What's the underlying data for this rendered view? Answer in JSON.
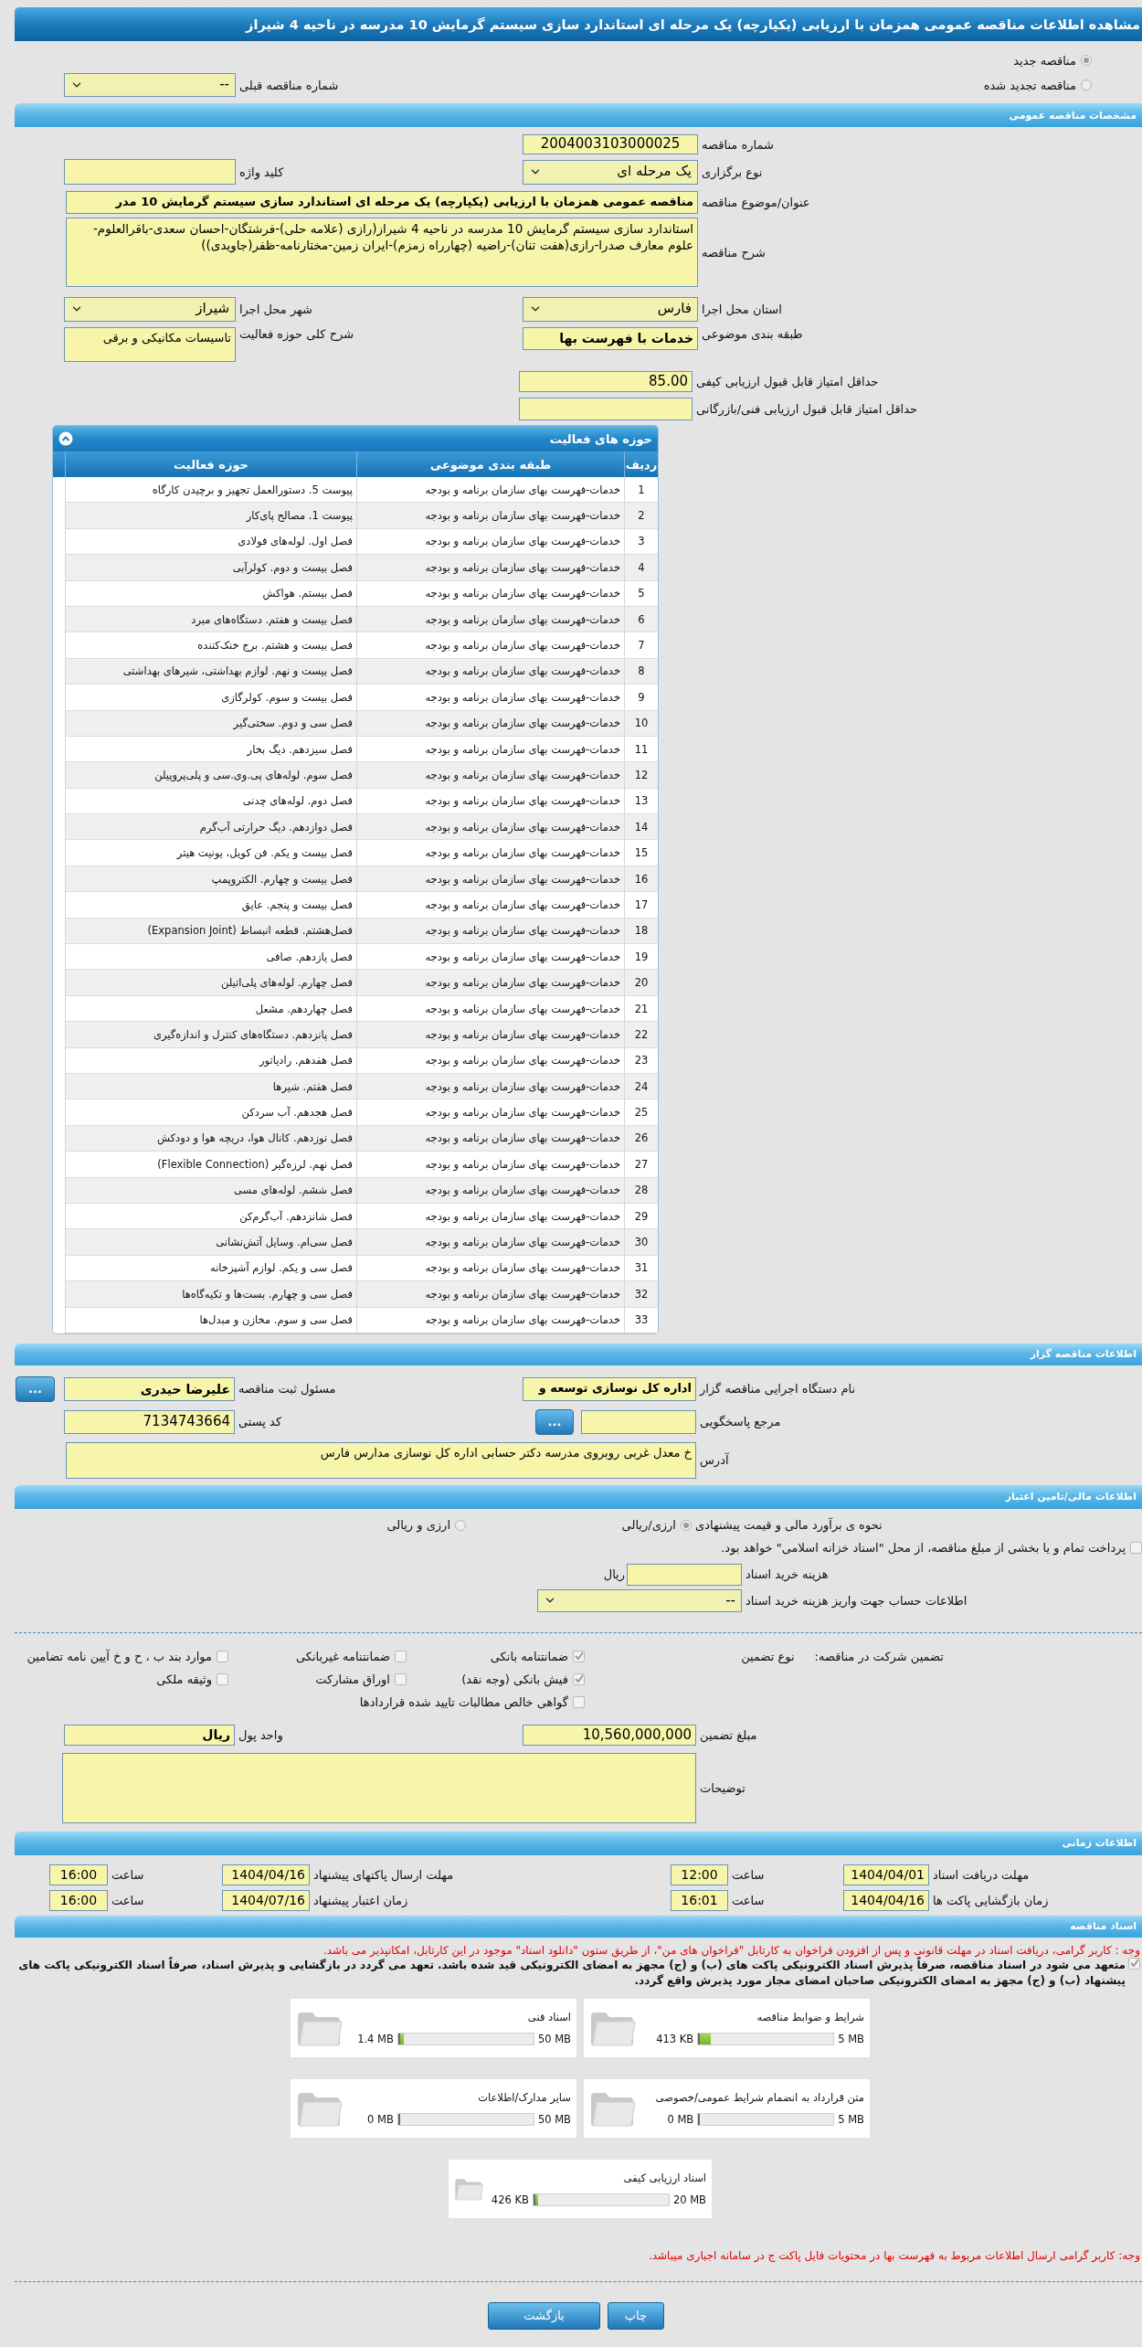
{
  "title": "مشاهده اطلاعات مناقصه عمومی همزمان با ارزیابی (یکپارچه) یک مرحله ای استاندارد سازی سیستم گرمایش 10 مدرسه در ناحیه 4 شیراز",
  "tender_kind": [
    {
      "label": "مناقصه جدید",
      "selected": true
    },
    {
      "label": "مناقصه تجدید شده",
      "selected": false
    }
  ],
  "previous_tender": {
    "label": "شماره مناقصه قبلی",
    "value": "--"
  },
  "general": {
    "header": "مشخصات مناقصه عمومی",
    "tender_number": {
      "label": "شماره مناقصه",
      "value": "2004003103000025"
    },
    "holding_type": {
      "label": "نوع برگزاری",
      "value": "یک مرحله ای"
    },
    "keyword": {
      "label": "کلید واژه"
    },
    "subject": {
      "label": "عنوان/موضوع مناقصه",
      "value": "مناقصه عمومی همزمان با ارزیابی (یکپارچه) یک مرحله ای استاندارد سازی سیستم گرمایش 10 مدر"
    },
    "description": {
      "label": "شرح مناقصه",
      "value": "استاندارد سازی سیستم گرمایش 10 مدرسه در ناحیه 4 شیراز(رازی (علامه حلی)-فرشتگان-احسان سعدی-باقرالعلوم-علوم معارف صدرا-رازی(هفت تنان)-راضیه (چهارراه زمزم)-ایران زمین-مختارنامه-ظفر(جاویدی))"
    },
    "province": {
      "label": "استان محل اجرا",
      "value": "فارس"
    },
    "city": {
      "label": "شهر محل اجرا",
      "value": "شیراز"
    },
    "category": {
      "label": "طبقه بندی موضوعی",
      "value": "خدمات با فهرست بها"
    },
    "activity_summary": {
      "label": "شرح کلی حوزه فعالیت",
      "value": "تاسیسات مکانیکی و برقی"
    },
    "min_quality_score": {
      "label": "حداقل امتیاز قابل قبول ارزیابی کیفی",
      "value": "85.00"
    },
    "min_technical_score": {
      "label": "حداقل امتیاز قابل قبول ارزیابی فنی/بازرگانی"
    }
  },
  "activities": {
    "header": "حوزه های فعالیت",
    "columns": [
      "ردیف",
      "طبقه بندی موضوعی",
      "حوزه فعالیت"
    ],
    "rows": [
      [
        "1",
        "خدمات-فهرست بهای سازمان برنامه و بودجه",
        "پیوست 5. دستورالعمل تجهیز و برچیدن کارگاه"
      ],
      [
        "2",
        "خدمات-فهرست بهای سازمان برنامه و بودجه",
        "پیوست 1. مصالح پای‌کار"
      ],
      [
        "3",
        "خدمات-فهرست بهای سازمان برنامه و بودجه",
        "فصل اول. لوله‌های فولادی"
      ],
      [
        "4",
        "خدمات-فهرست بهای سازمان برنامه و بودجه",
        "فصل بیست و دوم. کولرآبی"
      ],
      [
        "5",
        "خدمات-فهرست بهای سازمان برنامه و بودجه",
        "فصل بیستم. هواکش"
      ],
      [
        "6",
        "خدمات-فهرست بهای سازمان برنامه و بودجه",
        "فصل بیست و هفتم. دستگاه‌های مبرد"
      ],
      [
        "7",
        "خدمات-فهرست بهای سازمان برنامه و بودجه",
        "فصل بیست و هشتم. برج خنک‌کننده"
      ],
      [
        "8",
        "خدمات-فهرست بهای سازمان برنامه و بودجه",
        "فصل بیست و نهم. لوازم بهداشتی، شیرهای بهداشتی"
      ],
      [
        "9",
        "خدمات-فهرست بهای سازمان برنامه و بودجه",
        "فصل بیست و سوم. کولرگازی"
      ],
      [
        "10",
        "خدمات-فهرست بهای سازمان برنامه و بودجه",
        "فصل سی و دوم. سختی‌گیر"
      ],
      [
        "11",
        "خدمات-فهرست بهای سازمان برنامه و بودجه",
        "فصل سیزدهم. دیگ بخار"
      ],
      [
        "12",
        "خدمات-فهرست بهای سازمان برنامه و بودجه",
        "فصل سوم. لوله‌های پی.وی.سی و پلی‌پروپیلن"
      ],
      [
        "13",
        "خدمات-فهرست بهای سازمان برنامه و بودجه",
        "فصل دوم. لوله‌های چدنی"
      ],
      [
        "14",
        "خدمات-فهرست بهای سازمان برنامه و بودجه",
        "فصل دوازدهم. دیگ حرارتی آب‌گرم"
      ],
      [
        "15",
        "خدمات-فهرست بهای سازمان برنامه و بودجه",
        "فصل بیست و یکم. فن کویل، یونیت هیتر"
      ],
      [
        "16",
        "خدمات-فهرست بهای سازمان برنامه و بودجه",
        "فصل بیست و چهارم. الکتروپمپ"
      ],
      [
        "17",
        "خدمات-فهرست بهای سازمان برنامه و بودجه",
        "فصل بیست و پنجم. عایق"
      ],
      [
        "18",
        "خدمات-فهرست بهای سازمان برنامه و بودجه",
        "فصل‌هشتم. قطعه انبساط (Expansion Joint)"
      ],
      [
        "19",
        "خدمات-فهرست بهای سازمان برنامه و بودجه",
        "فصل یازدهم. صافی"
      ],
      [
        "20",
        "خدمات-فهرست بهای سازمان برنامه و بودجه",
        "فصل چهارم. لوله‌های پلی‌اتیلن"
      ],
      [
        "21",
        "خدمات-فهرست بهای سازمان برنامه و بودجه",
        "فصل چهاردهم. مشعل"
      ],
      [
        "22",
        "خدمات-فهرست بهای سازمان برنامه و بودجه",
        "فصل پانزدهم. دستگاه‌های کنترل و اندازه‌گیری"
      ],
      [
        "23",
        "خدمات-فهرست بهای سازمان برنامه و بودجه",
        "فصل هفدهم. رادیاتور"
      ],
      [
        "24",
        "خدمات-فهرست بهای سازمان برنامه و بودجه",
        "فصل هفتم. شیرها"
      ],
      [
        "25",
        "خدمات-فهرست بهای سازمان برنامه و بودجه",
        "فصل هجدهم. آب سردکن"
      ],
      [
        "26",
        "خدمات-فهرست بهای سازمان برنامه و بودجه",
        "فصل نوزدهم. کانال هوا، دریچه هوا و دودکش"
      ],
      [
        "27",
        "خدمات-فهرست بهای سازمان برنامه و بودجه",
        "فصل نهم. لرزه‌گیر (Flexible Connection)"
      ],
      [
        "28",
        "خدمات-فهرست بهای سازمان برنامه و بودجه",
        "فصل ششم. لوله‌های مسی"
      ],
      [
        "29",
        "خدمات-فهرست بهای سازمان برنامه و بودجه",
        "فصل شانزدهم. آب‌گرم‌کن"
      ],
      [
        "30",
        "خدمات-فهرست بهای سازمان برنامه و بودجه",
        "فصل سی‌ام. وسایل آتش‌نشانی"
      ],
      [
        "31",
        "خدمات-فهرست بهای سازمان برنامه و بودجه",
        "فصل سی و یکم. لوازم آشپزخانه"
      ],
      [
        "32",
        "خدمات-فهرست بهای سازمان برنامه و بودجه",
        "فصل سی و چهارم. بست‌ها و تکیه‌گاه‌ها"
      ],
      [
        "33",
        "خدمات-فهرست بهای سازمان برنامه و بودجه",
        "فصل سی و سوم. مخازن و مبدل‌ها"
      ]
    ]
  },
  "tenderer": {
    "header": "اطلاعات مناقصه گزار",
    "agency": {
      "label": "نام دستگاه اجرایی مناقصه گزار",
      "value": "اداره کل نوسازی توسعه و"
    },
    "registrar": {
      "label": "مسئول ثبت مناقصه",
      "value": "علیرضا حیدری",
      "button": "..."
    },
    "reference": {
      "label": "مرجع پاسخگویی",
      "button": "..."
    },
    "postal_code": {
      "label": "کد پستی",
      "value": "7134743664"
    },
    "address": {
      "label": "آدرس",
      "value": "خ معدل غربی روبروی مدرسه دکتر حسابی اداره کل نوسازی مدارس فارس"
    }
  },
  "finance": {
    "header": "اطلاعات مالی/تامین اعتبار",
    "estimate": {
      "label": "نحوه ی برآورد مالی و قیمت پیشنهادی",
      "options": [
        {
          "label": "ارزی/ریالی",
          "selected": true
        },
        {
          "label": "ارزی و ریالی",
          "selected": false
        }
      ]
    },
    "treasury": {
      "label": "پرداخت تمام و یا بخشی از مبلغ مناقصه، از محل \"اسناد خزانه اسلامی\" خواهد بود.",
      "checked": false
    },
    "document_fee": {
      "label": "هزینه خرید اسناد",
      "unit": "ریال"
    },
    "account": {
      "label": "اطلاعات حساب جهت واریز هزینه خرید اسناد",
      "value": "--"
    },
    "guarantee": {
      "label": "تضمین شرکت در مناقصه:",
      "type_label": "نوع تضمین",
      "options": [
        {
          "label": "ضمانتنامه بانکی",
          "checked": true
        },
        {
          "label": "ضمانتنامه غیربانکی",
          "checked": false
        },
        {
          "label": "موارد بند ب ، ح و خ آیین نامه تضامین",
          "checked": false
        },
        {
          "label": "فیش بانکی (وجه نقد)",
          "checked": true
        },
        {
          "label": "اوراق مشارکت",
          "checked": false
        },
        {
          "label": "وثیقه ملکی",
          "checked": false
        },
        {
          "label": "گواهی خالص مطالبات تایید شده قراردادها",
          "checked": false
        }
      ]
    },
    "amount": {
      "label": "مبلغ تضمین",
      "value": "10,560,000,000"
    },
    "currency": {
      "label": "واحد پول",
      "value": "ریال"
    },
    "notes": {
      "label": "توضیحات"
    }
  },
  "schedule": {
    "header": "اطلاعات زمانی",
    "rows": [
      [
        {
          "label": "مهلت دریافت اسناد",
          "date": "1404/04/01",
          "time_label": "ساعت",
          "time": "12:00"
        },
        {
          "label": "مهلت ارسال پاکتهای پیشنهاد",
          "date": "1404/04/16",
          "time_label": "ساعت",
          "time": "16:00"
        }
      ],
      [
        {
          "label": "زمان بازگشایی پاکت ها",
          "date": "1404/04/16",
          "time_label": "ساعت",
          "time": "16:01"
        },
        {
          "label": "زمان اعتبار پیشنهاد",
          "date": "1404/07/16",
          "time_label": "ساعت",
          "time": "16:00"
        }
      ]
    ]
  },
  "documents": {
    "header": "اسناد مناقصه",
    "notice": "وجه : کاربر گرامی، دریافت اسناد در مهلت قانونی و پس از افزودن فراخوان به کارتابل \"فراخوان های من\"، از طریق ستون \"دانلود اسناد\" موجود در این کارتابل، امکانپذیر می باشد.",
    "commitment": {
      "text": "متعهد می شود در اسناد مناقصه، صرفاً پذیرش اسناد الکترونیکی پاکت های (ب) و (ج) مجهز به امضای الکترونیکی قید شده باشد. تعهد می گردد در بازگشایی و پذیرش اسناد، صرفاً اسناد الکترونیکی پاکت های پیشنهاد (ب) و (ج) مجهز به امضای الکترونیکی صاحبان امضای مجاز مورد پذیرش واقع گردد.",
      "checked": true
    },
    "files": [
      {
        "title": "شرایط و ضوابط مناقصه",
        "used": "413 KB",
        "max": "5 MB",
        "level": 0.08
      },
      {
        "title": "اسناد فنی",
        "used": "1.4 MB",
        "max": "50 MB",
        "level": 0.03
      },
      {
        "title": "متن قرارداد به انضمام شرایط عمومی/خصوصی",
        "used": "0 MB",
        "max": "5 MB",
        "level": 0
      },
      {
        "title": "سایر مدارک/اطلاعات",
        "used": "0 MB",
        "max": "50 MB",
        "level": 0
      },
      {
        "title": "اسناد ارزیابی کیفی",
        "used": "426 KB",
        "max": "20 MB",
        "level": 0.02
      }
    ],
    "footer_notice": "وجه: کاربر گرامی ارسال اطلاعات مربوط به فهرست بها در محتویات فایل پاکت ج در سامانه اجباری میباشد."
  },
  "buttons": [
    "چاپ",
    "بازگشت"
  ]
}
